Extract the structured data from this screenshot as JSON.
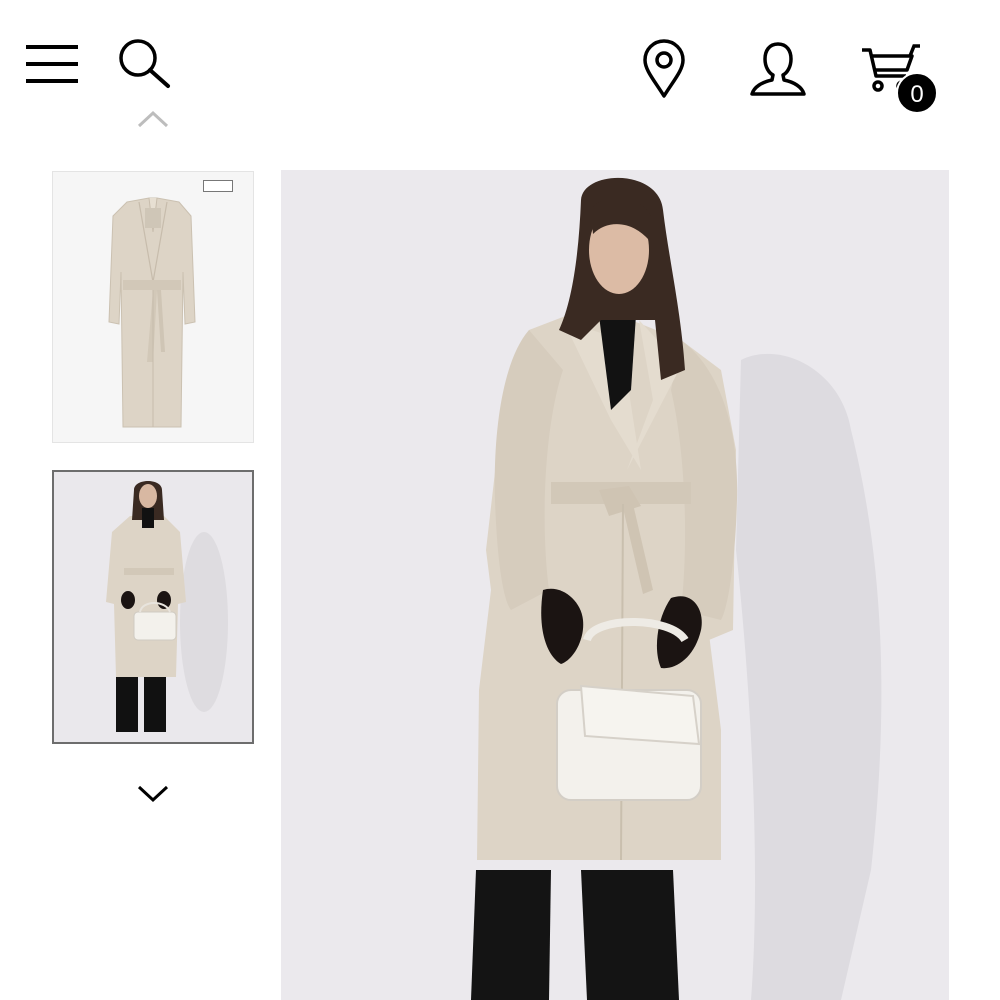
{
  "header": {
    "menu_icon": "hamburger-menu-icon",
    "search_icon": "search-icon",
    "store_locator_icon": "location-pin-icon",
    "account_icon": "user-icon",
    "cart_icon": "shopping-cart-icon",
    "cart_count": "0"
  },
  "gallery": {
    "up_arrow_icon": "chevron-up-icon",
    "down_arrow_icon": "chevron-down-icon",
    "thumbnails": [
      {
        "selected": false,
        "tag_text": ""
      },
      {
        "selected": true
      }
    ]
  },
  "colors": {
    "badge_bg": "#000000",
    "coat": "#ddd4c6",
    "backdrop": "#ebe9ed",
    "selected_thumb_border": "#6d6d6d"
  }
}
